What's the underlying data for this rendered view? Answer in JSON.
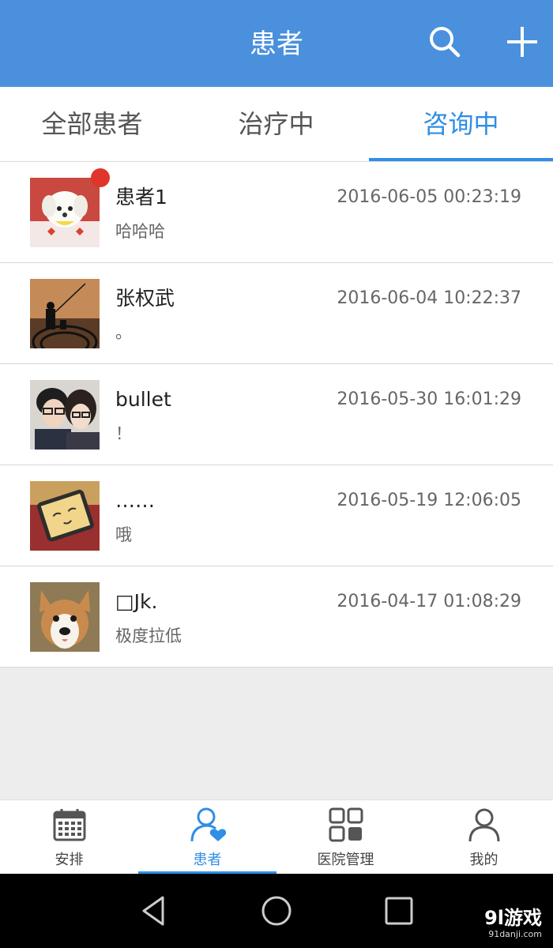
{
  "header": {
    "title": "患者",
    "icons": [
      "search-icon",
      "add-icon"
    ],
    "color": "#4a90dc"
  },
  "tabs": [
    {
      "label": "全部患者"
    },
    {
      "label": "治疗中"
    },
    {
      "label": "咨询中",
      "active": true
    }
  ],
  "conversations": [
    {
      "name": "患者1",
      "message": "哈哈哈",
      "time": "2016-06-05 00:23:19",
      "unread": true,
      "avatar": "white-puppy-photo"
    },
    {
      "name": "张权武",
      "message": "。",
      "time": "2016-06-04 10:22:37",
      "unread": false,
      "avatar": "fishing-silhouette-photo"
    },
    {
      "name": "bullet",
      "message": "！",
      "time": "2016-05-30 16:01:29",
      "unread": false,
      "avatar": "couple-photo"
    },
    {
      "name": "……",
      "message": "哦",
      "time": "2016-05-19 12:06:05",
      "unread": false,
      "avatar": "smiling-tablet-photo"
    },
    {
      "name": "□Jk.",
      "message": "极度拉低",
      "time": "2016-04-17 01:08:29",
      "unread": false,
      "avatar": "corgi-photo"
    }
  ],
  "bottom_nav": [
    {
      "label": "安排",
      "icon": "calendar-icon"
    },
    {
      "label": "患者",
      "icon": "patient-heart-icon",
      "active": true
    },
    {
      "label": "医院管理",
      "icon": "grid-icon"
    },
    {
      "label": "我的",
      "icon": "person-icon"
    }
  ],
  "system_nav": [
    "back-icon",
    "home-icon",
    "recents-icon"
  ],
  "watermark": {
    "main": "9l游戏",
    "sub": "91danji.com"
  },
  "colors": {
    "accent": "#2f8ee5",
    "badge": "#e0352b"
  }
}
